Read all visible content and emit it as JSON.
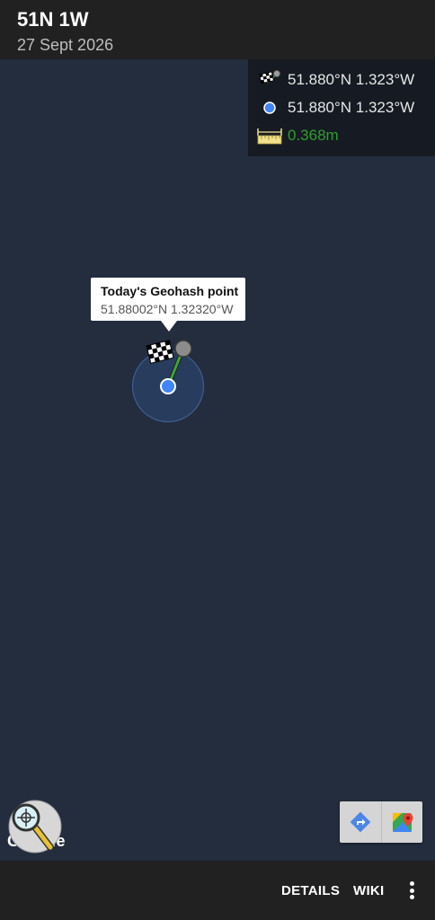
{
  "app_bar": {
    "title": "51N 1W",
    "subtitle": "27 Sept 2026"
  },
  "info_panel": {
    "destination_icon": "checkered-flag-icon",
    "destination_coords": "51.880°N 1.323°W",
    "location_icon": "blue-dot-icon",
    "location_coords": "51.880°N 1.323°W",
    "distance_icon": "ruler-icon",
    "distance": "0.368m",
    "distance_color": "#2e9e2e"
  },
  "callout": {
    "title": "Today's Geohash point",
    "coords": "51.88002°N 1.32320°W"
  },
  "map": {
    "background_color": "#232d3e",
    "location_dot_color": "#4285f4",
    "zoom_button_icon": "magnifier-icon",
    "attribution": "Google",
    "directions_icon": "directions-icon",
    "maps_icon": "google-maps-icon"
  },
  "bottom_bar": {
    "details_label": "DETAILS",
    "wiki_label": "WIKI",
    "overflow_icon": "more-vert-icon"
  }
}
